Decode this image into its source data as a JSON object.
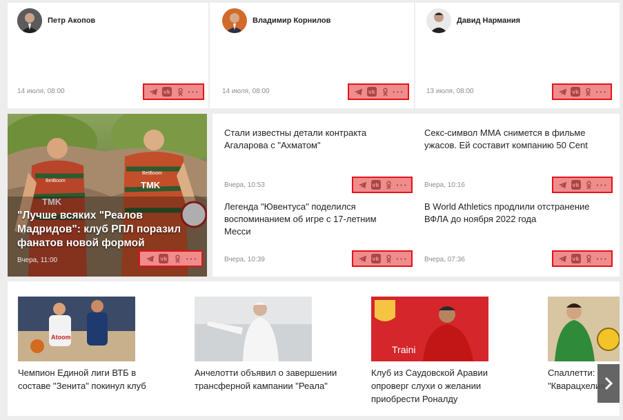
{
  "authors": [
    {
      "name": "Петр Акопов",
      "date": "14 июля, 08:00"
    },
    {
      "name": "Владимир Корнилов",
      "date": "14 июля, 08:00"
    },
    {
      "name": "Давид Нармания",
      "date": "13 июля, 08:00"
    }
  ],
  "featured": {
    "title": "\"Лучше всяких \"Реалов Мадридов\": клуб РПЛ поразил фанатов новой формой",
    "date": "Вчера, 11:00",
    "jersey_text": "TMK",
    "sponsor_text": "BetBoom"
  },
  "news": [
    {
      "title": "Стали известны детали контракта Агаларова с \"Ахматом\"",
      "date": "Вчера, 10:53"
    },
    {
      "title": "Секс-символ ММА снимется в фильме ужасов. Ей составит компанию 50 Cent",
      "date": "Вчера, 10:16"
    },
    {
      "title": "Легенда \"Ювентуса\" поделился воспоминанием об игре с 17-летним Месси",
      "date": "Вчера, 10:39"
    },
    {
      "title": "В World Athletics продлили отстранение ВФЛА до ноября 2022 года",
      "date": "Вчера, 07:36"
    }
  ],
  "gallery": [
    {
      "caption": "Чемпион Единой лиги ВТБ в составе \"Зенита\" покинул клуб",
      "image_text": "Atoom"
    },
    {
      "caption": "Анчелотти объявил о завершении трансферной кампании \"Реала\"",
      "image_text": ""
    },
    {
      "caption": "Клуб из Саудовской Аравии опроверг слухи о желании приобрести Роналду",
      "image_text": "Traini"
    },
    {
      "caption": "Спаллетти: \"Кварацхелия может заменить в Нап",
      "image_text": ""
    }
  ],
  "icons": {
    "share": [
      "telegram-icon",
      "vk-icon",
      "ok-icon",
      "more-icon"
    ],
    "next": "chevron-right-icon"
  },
  "colors": {
    "highlight_border": "#e3121b",
    "highlight_fill": "#ef8d8d"
  }
}
